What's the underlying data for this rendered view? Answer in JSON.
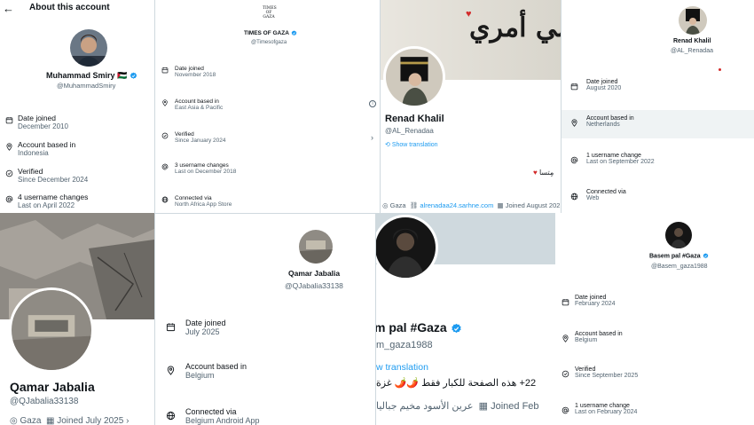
{
  "p1": {
    "header_title": "About this account",
    "name": "Muhammad Smiry",
    "flag_emoji": "🇵🇸",
    "handle": "@MuhammadSmiry",
    "rows": [
      {
        "label": "Date joined",
        "value": "December 2010",
        "icon": "calendar-icon"
      },
      {
        "label": "Account based in",
        "value": "Indonesia",
        "icon": "location-pin-icon"
      },
      {
        "label": "Verified",
        "value": "Since December 2024",
        "icon": "verified-check-icon"
      },
      {
        "label": "4 username changes",
        "value": "Last on April 2022",
        "icon": "at-sign-icon"
      }
    ]
  },
  "p2": {
    "logo_text": "TIMES OF GAZA",
    "name": "TIMES OF GAZA",
    "handle": "@Timesofgaza",
    "rows": [
      {
        "label": "Date joined",
        "value": "November 2018",
        "icon": "calendar-icon"
      },
      {
        "label": "Account based in",
        "value": "East Asia & Pacific",
        "icon": "location-pin-icon"
      },
      {
        "label": "Verified",
        "value": "Since January 2024",
        "icon": "verified-check-icon"
      },
      {
        "label": "3 username changes",
        "value": "Last on December 2018",
        "icon": "at-sign-icon"
      },
      {
        "label": "Connected via",
        "value": "North Africa App Store",
        "icon": "globe-icon"
      }
    ]
  },
  "p3": {
    "banner_text": "لي أمري",
    "name": "Renad Khalil",
    "handle": "@AL_Renadaa",
    "show_translation": "Show translation",
    "bio_fragment": "مِتسا",
    "location": "Gaza",
    "link": "alrenadaa24.sarhne.com",
    "joined": "Joined August 202"
  },
  "p4": {
    "name": "Renad Khalil",
    "handle": "@AL_Renadaa",
    "rows": [
      {
        "label": "Date joined",
        "value": "August 2020",
        "icon": "calendar-icon"
      },
      {
        "label": "Account based in",
        "value": "Netherlands",
        "icon": "location-pin-icon"
      },
      {
        "label": "1 username change",
        "value": "Last on September 2022",
        "icon": "at-sign-icon"
      },
      {
        "label": "Connected via",
        "value": "Web",
        "icon": "globe-icon"
      }
    ]
  },
  "p5": {
    "name": "Qamar Jabalia",
    "handle": "@QJabalia33138",
    "location": "Gaza",
    "joined": "Joined July 2025"
  },
  "p6": {
    "name": "Qamar Jabalia",
    "handle": "@QJabalia33138",
    "rows": [
      {
        "label": "Date joined",
        "value": "July 2025",
        "icon": "calendar-icon"
      },
      {
        "label": "Account based in",
        "value": "Belgium",
        "icon": "location-pin-icon"
      },
      {
        "label": "Connected via",
        "value": "Belgium Android App",
        "icon": "globe-icon"
      }
    ]
  },
  "p7": {
    "name": "m pal #Gaza",
    "handle": "m_gaza1988",
    "translation": "w translation",
    "bio_line": "22+ هذه الصفحة للكبار فقط 🌶️🌶️ غزة",
    "place_line": "عرين الأسود مخيم جباليا",
    "joined": "Joined Feb"
  },
  "p8": {
    "name": "Basem pal #Gaza",
    "handle": "@Basem_gaza1988",
    "rows": [
      {
        "label": "Date joined",
        "value": "February 2024",
        "icon": "calendar-icon"
      },
      {
        "label": "Account based in",
        "value": "Belgium",
        "icon": "location-pin-icon"
      },
      {
        "label": "Verified",
        "value": "Since September 2025",
        "icon": "verified-check-icon"
      },
      {
        "label": "1 username change",
        "value": "Last on February 2024",
        "icon": "at-sign-icon"
      }
    ]
  },
  "colors": {
    "accent": "#1d9bf0",
    "text": "#0f1419",
    "muted": "#536471",
    "border": "#cfd9de",
    "highlight": "#eff3f4"
  }
}
